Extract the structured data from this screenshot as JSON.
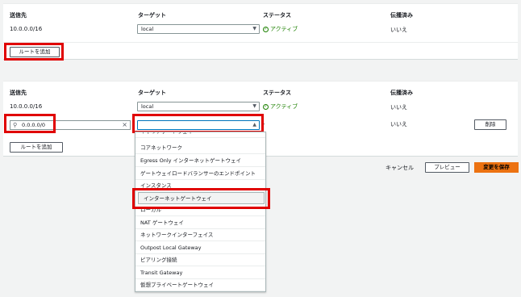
{
  "columns": {
    "destination": "送信先",
    "target": "ターゲット",
    "status": "ステータス",
    "propagated": "伝播済み"
  },
  "panel1": {
    "row": {
      "destination": "10.0.0.0/16",
      "target": "local",
      "status": "アクティブ",
      "propagated": "いいえ"
    },
    "add_route": "ルートを追加"
  },
  "panel2": {
    "row1": {
      "destination": "10.0.0.0/16",
      "target": "local",
      "status": "アクティブ",
      "propagated": "いいえ"
    },
    "row2": {
      "search_value": "0.0.0.0/0",
      "target": "",
      "status": "-",
      "propagated": "いいえ",
      "remove": "削除"
    },
    "add_route": "ルートを追加"
  },
  "footer": {
    "cancel": "キャンセル",
    "preview": "プレビュー",
    "save": "変更を保存"
  },
  "dropdown": {
    "options": [
      "キャリアゲートウェイ",
      "コアネットワーク",
      "Egress Only インターネットゲートウェイ",
      "ゲートウェイロードバランサーのエンドポイント",
      "インスタンス",
      "インターネットゲートウェイ",
      "ローカル",
      "NAT ゲートウェイ",
      "ネットワークインターフェイス",
      "Outpost Local Gateway",
      "ピアリング接続",
      "Transit Gateway",
      "仮想プライベートゲートウェイ"
    ],
    "highlighted": "インターネットゲートウェイ"
  },
  "colors": {
    "accent": "#ec7211",
    "status_green": "#1d8102",
    "highlight_red": "#e00000"
  }
}
